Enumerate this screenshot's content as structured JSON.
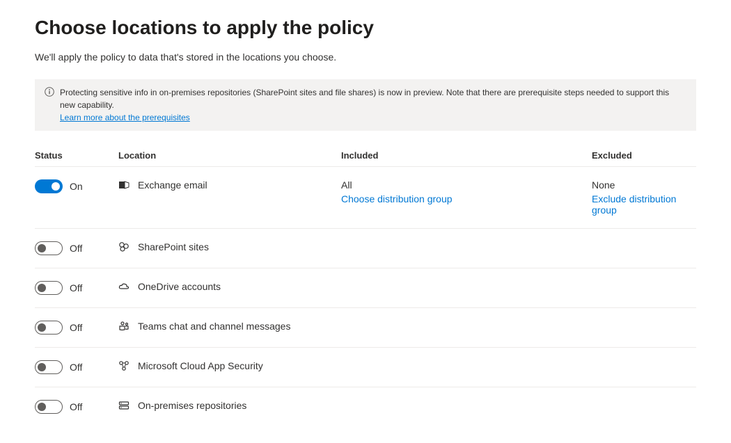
{
  "page": {
    "title": "Choose locations to apply the policy",
    "subtitle": "We'll apply the policy to data that's stored in the locations you choose."
  },
  "banner": {
    "text": "Protecting sensitive info in on-premises repositories (SharePoint sites and file shares) is now in preview. Note that there are prerequisite steps needed to support this new capability.",
    "link": "Learn more about the prerequisites"
  },
  "headers": {
    "status": "Status",
    "location": "Location",
    "included": "Included",
    "excluded": "Excluded"
  },
  "toggle_labels": {
    "on": "On",
    "off": "Off"
  },
  "rows": [
    {
      "on": true,
      "location": "Exchange email",
      "icon": "exchange-icon",
      "included_value": "All",
      "included_link": "Choose distribution group",
      "excluded_value": "None",
      "excluded_link": "Exclude distribution group"
    },
    {
      "on": false,
      "location": "SharePoint sites",
      "icon": "sharepoint-icon"
    },
    {
      "on": false,
      "location": "OneDrive accounts",
      "icon": "onedrive-icon"
    },
    {
      "on": false,
      "location": "Teams chat and channel messages",
      "icon": "teams-icon"
    },
    {
      "on": false,
      "location": "Microsoft Cloud App Security",
      "icon": "mcas-icon"
    },
    {
      "on": false,
      "location": "On-premises repositories",
      "icon": "onprem-icon"
    }
  ]
}
